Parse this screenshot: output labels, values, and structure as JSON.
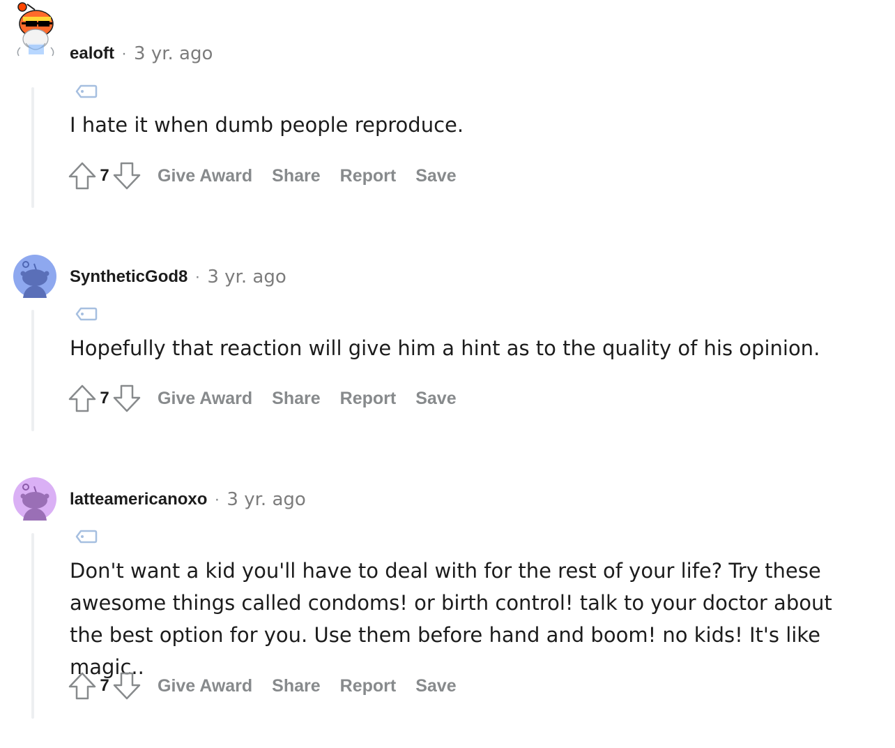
{
  "comments": [
    {
      "author": "ealoft",
      "separator": "·",
      "time": "3 yr. ago",
      "text": "I hate it when dumb people reproduce.",
      "score": "7",
      "avatar_icon": "snoo-sunglasses-avatar-icon",
      "actions": {
        "give_award": "Give Award",
        "share": "Share",
        "report": "Report",
        "save": "Save"
      }
    },
    {
      "author": "SyntheticGod8",
      "separator": "·",
      "time": "3 yr. ago",
      "text": "Hopefully that reaction will give him a hint as to the quality of his opinion.",
      "score": "7",
      "avatar_icon": "snoo-default-blue-avatar-icon",
      "actions": {
        "give_award": "Give Award",
        "share": "Share",
        "report": "Report",
        "save": "Save"
      }
    },
    {
      "author": "latteamericanoxo",
      "separator": "·",
      "time": "3 yr. ago",
      "text": "Don't want a kid you'll have to deal with for the rest of your life? Try these awesome things called condoms! or birth control! talk to your doctor about the best option for you. Use them before hand and boom! no kids! It's like magic..",
      "score": "7",
      "avatar_icon": "snoo-default-purple-avatar-icon",
      "actions": {
        "give_award": "Give Award",
        "share": "Share",
        "report": "Report",
        "save": "Save"
      }
    }
  ],
  "colors": {
    "avatar_blue_bg": "#8ea8ef",
    "avatar_purple_bg": "#dab0f5",
    "meta_gray": "#878a8c",
    "thread_line": "#edeff1",
    "flair_blue": "#a6bfe0"
  }
}
